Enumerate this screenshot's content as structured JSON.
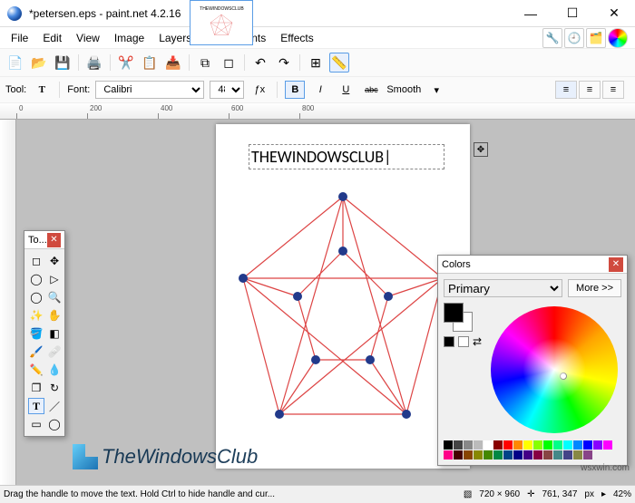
{
  "window": {
    "title": "*petersen.eps - paint.net 4.2.16",
    "minimize": "—",
    "maximize": "☐",
    "close": "✕"
  },
  "menu": {
    "file": "File",
    "edit": "Edit",
    "view": "View",
    "image": "Image",
    "layers": "Layers",
    "adjustments": "Adjustments",
    "effects": "Effects"
  },
  "tool_options": {
    "tool_label": "Tool:",
    "font_label": "Font:",
    "font_name": "Calibri",
    "font_size": "48",
    "bold": "B",
    "italic": "I",
    "underline": "U",
    "strike": "abc",
    "smooth_label": "Smooth"
  },
  "ruler": {
    "px_label": "px",
    "marks": [
      "0",
      "200",
      "400",
      "600",
      "800"
    ]
  },
  "canvas": {
    "text": "THEWINDOWSCLUB",
    "thumb_text": "THEWINDOWSCLUB"
  },
  "tools_panel": {
    "title": "To..."
  },
  "colors_panel": {
    "title": "Colors",
    "primary_label": "Primary",
    "more_btn": "More >>"
  },
  "status": {
    "hint": "Drag the handle to move the text. Hold Ctrl to hide handle and cur...",
    "doc_size": "720 × 960",
    "cursor_pos": "761, 347",
    "unit": "px",
    "zoom": "42%",
    "zoom_glyph": "▸"
  },
  "watermark": "TheWindowsClub",
  "site": "wsxwin.com",
  "palette_colors": [
    "#000",
    "#444",
    "#888",
    "#bbb",
    "#fff",
    "#800",
    "#f00",
    "#f80",
    "#ff0",
    "#8f0",
    "#0f0",
    "#0f8",
    "#0ff",
    "#08f",
    "#00f",
    "#80f",
    "#f0f",
    "#f08",
    "#400",
    "#840",
    "#880",
    "#480",
    "#084",
    "#048",
    "#008",
    "#408",
    "#804",
    "#844",
    "#488",
    "#448",
    "#884",
    "#848"
  ]
}
